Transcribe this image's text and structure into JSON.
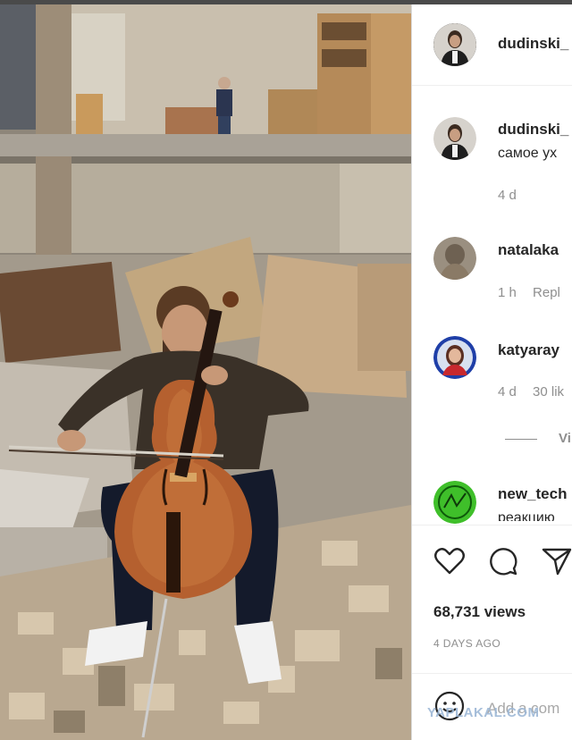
{
  "post": {
    "header_username": "dudinski_",
    "comments": [
      {
        "username": "dudinski_",
        "text": "самое ух",
        "meta": [
          "4 d"
        ]
      },
      {
        "username": "natalaka",
        "text": "",
        "meta": [
          "1 h",
          "Repl"
        ]
      },
      {
        "username": "katyaray",
        "text": "",
        "meta": [
          "4 d",
          "30 lik"
        ]
      },
      {
        "username": "new_tech",
        "text": "реакцию",
        "meta": []
      }
    ],
    "view_replies_label": "Vi",
    "views_label": "68,731 views",
    "time_ago_label": "4 DAYS AGO",
    "add_comment_placeholder": "Add a com"
  },
  "watermark": "YAPLAKAL.COM",
  "icons": {
    "like": "heart-icon",
    "comment": "comment-icon",
    "share": "paper-plane-icon",
    "emoji": "smiley-icon"
  },
  "colors": {
    "text": "#262626",
    "muted": "#8e8e8e",
    "divider": "#dbdbdb",
    "new_tech_avatar": "#3fbf2a"
  }
}
